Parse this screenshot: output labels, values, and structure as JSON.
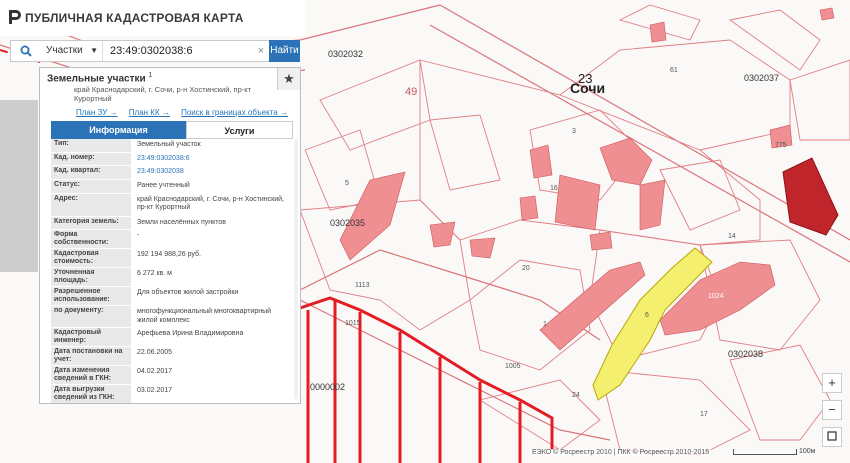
{
  "app": {
    "title": "ПУБЛИЧНАЯ КАДАСТРОВАЯ КАРТА"
  },
  "search": {
    "scope": "Участки",
    "query": "23:49:0302038:6",
    "submit_label": "Найти",
    "clear": "×"
  },
  "panel": {
    "title": "Земельные участки",
    "title_sup": "1",
    "address_cut": "край Краснодарский, г. Сочи, р-н Хостинский, пр-кт Курортный",
    "links": [
      "План ЗУ →",
      "План КК →",
      "Поиск в границах объекта →"
    ],
    "tabs": {
      "info": "Информация",
      "services": "Услуги"
    },
    "rows": [
      {
        "label": "Тип:",
        "value": "Земельный участок",
        "link": false
      },
      {
        "label": "Кад. номер:",
        "value": "23:49:0302038:6",
        "link": true
      },
      {
        "label": "Кад. квартал:",
        "value": "23:49:0302038",
        "link": true
      },
      {
        "label": "Статус:",
        "value": "Ранее учтенный",
        "link": false
      },
      {
        "label": "Адрес:",
        "value": "край Краснодарский, г. Сочи, р-н Хостинский, пр-кт Курортный",
        "link": false
      },
      {
        "label": "Категория земель:",
        "value": "Земли населённых пунктов",
        "link": false
      },
      {
        "label": "Форма собственности:",
        "value": "-",
        "link": false
      },
      {
        "label": "Кадастровая стоимость:",
        "value": "192 194 988,26 руб.",
        "link": false
      },
      {
        "label": "Уточненная площадь:",
        "value": "6 272 кв. м",
        "link": false
      },
      {
        "label": "Разрешенное использование:",
        "value": "Для объектов жилой застройки",
        "link": false
      },
      {
        "label": "по документу:",
        "value": "многофункциональный многоквартирный жилой комплекс",
        "link": false
      },
      {
        "label": "Кадастровый инженер:",
        "value": "Арефьева Ирина Владимировна",
        "link": false
      },
      {
        "label": "Дата постановки на учет:",
        "value": "22.06.2005",
        "link": false
      },
      {
        "label": "Дата изменения сведений в ГКН:",
        "value": "04.02.2017",
        "link": false
      },
      {
        "label": "Дата выгрузки сведений из ГКН:",
        "value": "03.02.2017",
        "link": false
      }
    ]
  },
  "map": {
    "city_label": "Сочи",
    "district_number": "23",
    "quarter_labels": [
      "0302032",
      "0302037",
      "0302035",
      "0302038",
      "0000002"
    ],
    "parcel_labels": [
      "49",
      "5",
      "3",
      "16",
      "14",
      "20",
      "1",
      "6",
      "17",
      "775",
      "1113",
      "1005",
      "1024",
      "1015",
      "24",
      "61"
    ],
    "colors": {
      "parcel_line": "#d9747a",
      "building_fill": "#ef8f92",
      "highlight_fill": "#c0252b",
      "selected_fill": "#f4ef6f",
      "route": "#e31b23"
    }
  },
  "controls": {
    "zoom_in": "+",
    "zoom_out": "−",
    "star_icon": "★"
  },
  "footer": {
    "attribution": "ЕЭКО © Росреестр 2010 | ПКК © Росреестр 2010-2015",
    "scale": "100м"
  }
}
